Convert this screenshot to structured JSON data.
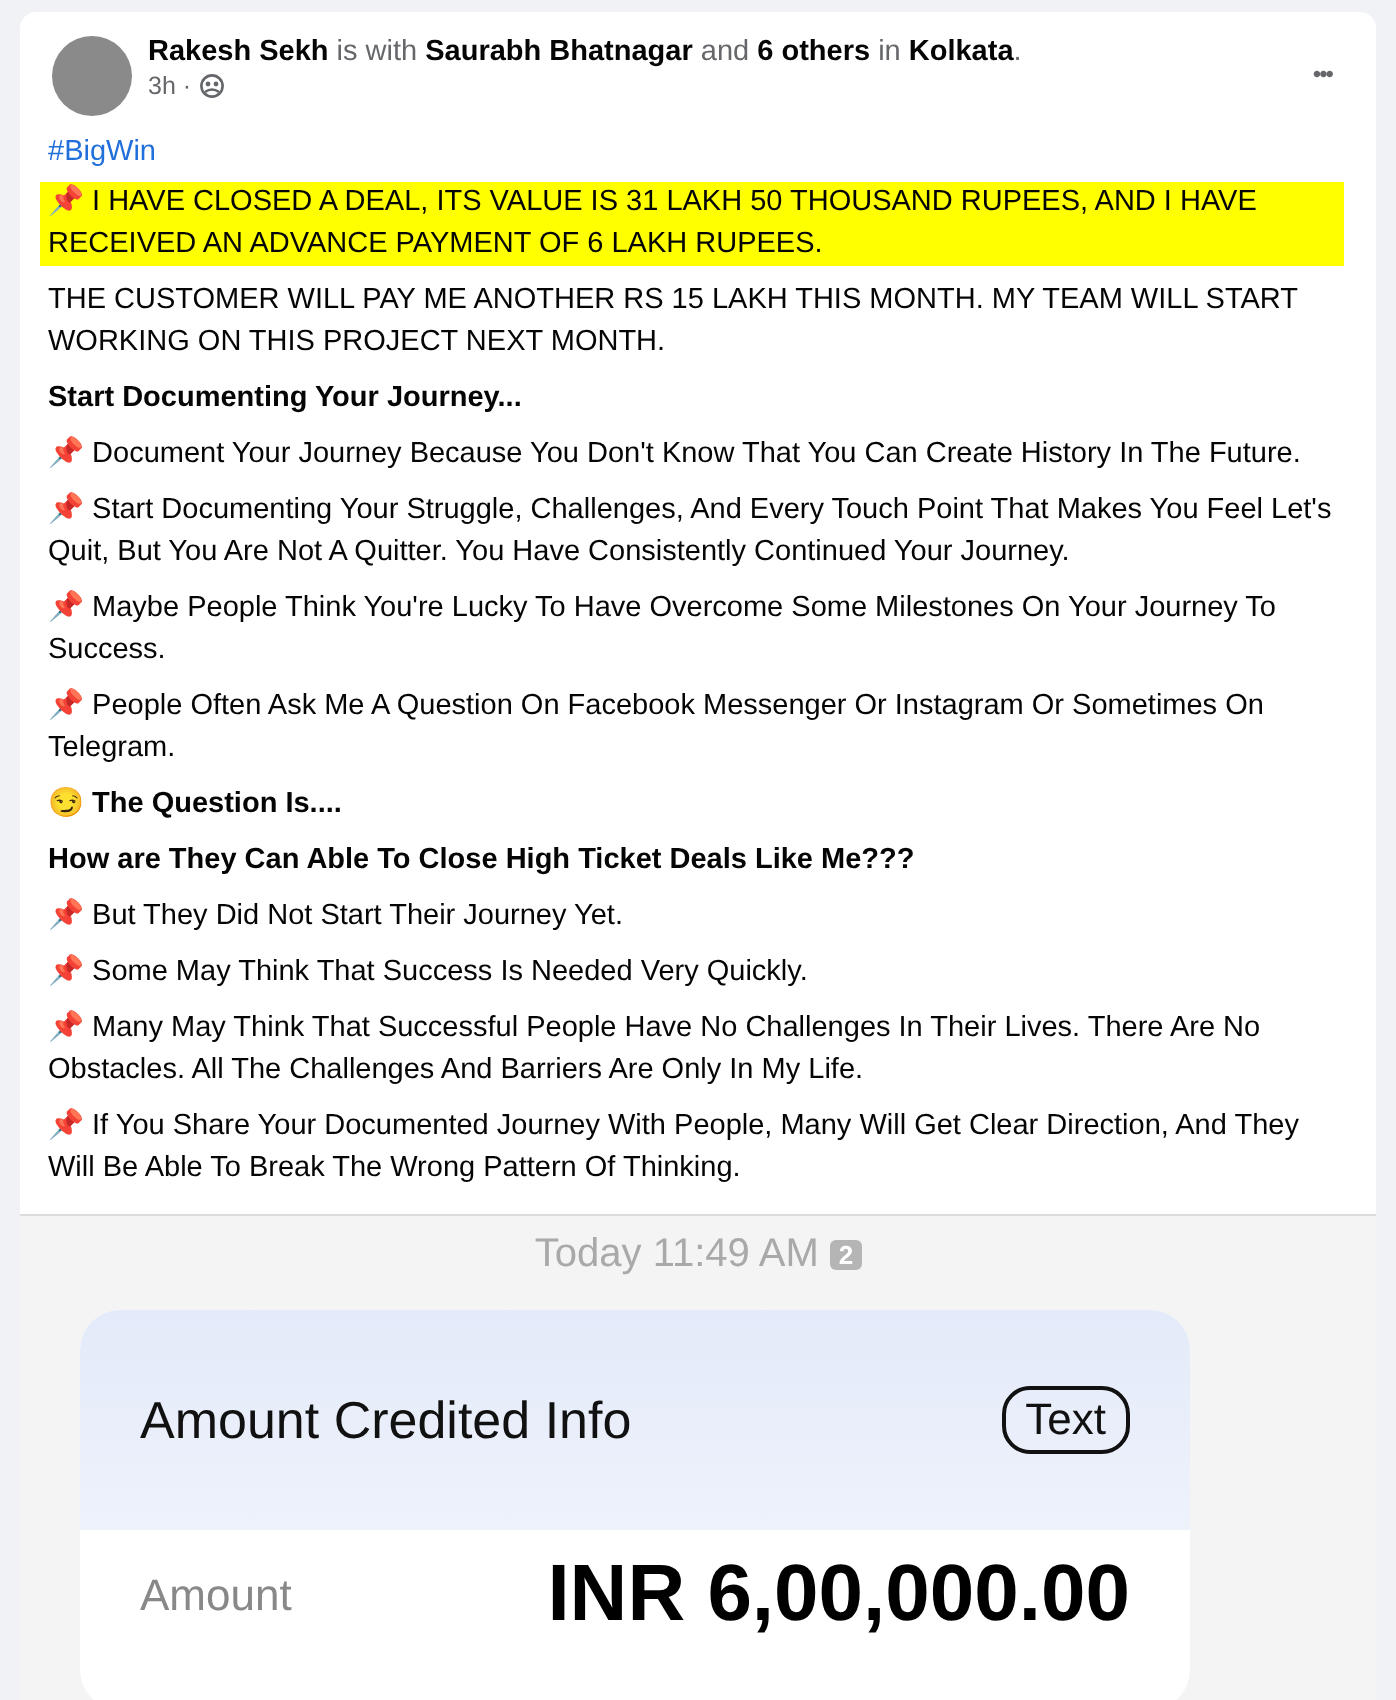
{
  "post": {
    "author_line": "**Rakesh Sekh** is with **Saurabh Bhatnagar** and **6 others** in **Kolkata**.",
    "time": "3h ·",
    "more": "•••",
    "hashtag": "#BigWin",
    "paragraphs": [
      {
        "kind": "highlight",
        "text": "📌 I HAVE CLOSED A DEAL, ITS VALUE IS 31 LAKH 50 THOUSAND RUPEES, AND I HAVE RECEIVED AN ADVANCE PAYMENT OF 6 LAKH RUPEES."
      },
      {
        "kind": "plain",
        "text": "THE CUSTOMER WILL PAY ME ANOTHER RS 15 LAKH THIS MONTH. MY TEAM WILL START WORKING ON THIS PROJECT NEXT MONTH."
      },
      {
        "kind": "bold",
        "text": "Start Documenting Your Journey..."
      },
      {
        "kind": "plain",
        "text": "📌 Document Your Journey Because You Don't Know That You Can Create History In The Future."
      },
      {
        "kind": "plain",
        "text": "📌 Start Documenting Your Struggle, Challenges, And Every Touch Point That Makes You Feel Let's Quit, But You Are Not A Quitter. You Have Consistently Continued Your Journey."
      },
      {
        "kind": "plain",
        "text": "📌 Maybe People Think You're Lucky To Have Overcome Some Milestones On Your Journey To Success."
      },
      {
        "kind": "plain",
        "text": "📌 People Often Ask Me A Question On Facebook Messenger Or Instagram Or Sometimes On Telegram."
      },
      {
        "kind": "plain",
        "text": "😏 **The Question Is....**"
      },
      {
        "kind": "bold",
        "text": "How are They Can Able To Close High Ticket Deals Like Me???"
      },
      {
        "kind": "plain",
        "text": "📌 But They Did Not Start Their Journey Yet."
      },
      {
        "kind": "plain",
        "text": "📌 Some May Think That Success Is Needed Very Quickly."
      },
      {
        "kind": "plain",
        "text": "📌 Many May Think That Successful People Have No Challenges In Their Lives. There Are No Obstacles. All The Challenges And Barriers Are Only In My Life."
      },
      {
        "kind": "plain",
        "text": "📌 If You Share Your Documented Journey With People, Many Will Get Clear Direction, And They Will Be Able To Break The Wrong Pattern Of Thinking."
      }
    ]
  },
  "attachment": {
    "timestamp": "Today 11:49 AM",
    "sim_badge": "2",
    "card_title": "Amount Credited Info",
    "card_button": "Text",
    "amount_label": "Amount",
    "amount_value": "INR 6,00,000.00"
  }
}
